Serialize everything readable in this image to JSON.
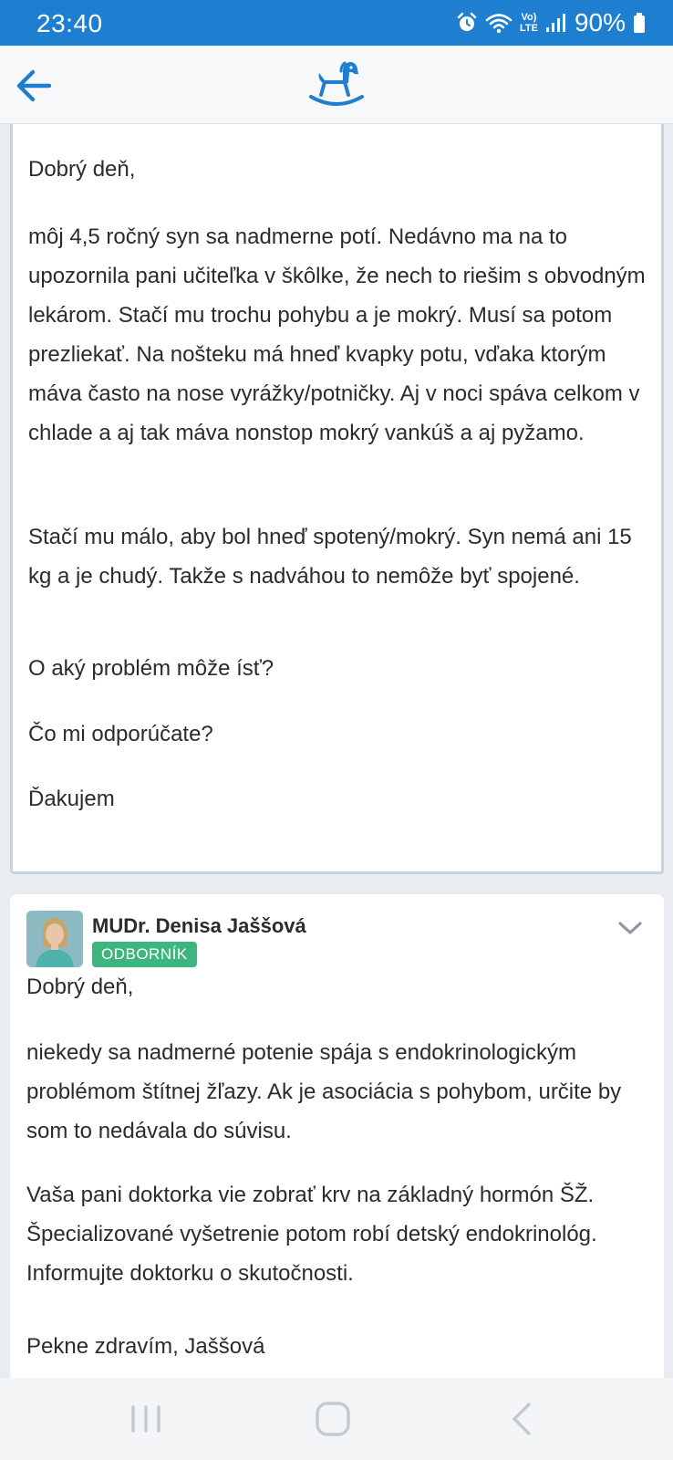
{
  "status_bar": {
    "time": "23:40",
    "battery": "90%",
    "network_label_top": "Vo)",
    "network_label_bottom": "LTE",
    "icons": [
      "alarm-icon",
      "wifi-icon",
      "volte-icon",
      "signal-icon",
      "battery-icon"
    ]
  },
  "app_bar": {
    "back_icon": "arrow-left-icon",
    "logo_icon": "rocking-horse-icon"
  },
  "colors": {
    "status_bar": "#1e7fd0",
    "accent": "#1e7fd0",
    "badge": "#3cb57e",
    "text": "#2b2b2b"
  },
  "question": {
    "greeting": "Dobrý deň,",
    "paragraphs": [
      "môj 4,5 ročný syn sa nadmerne potí. Nedávno ma na to upozornila pani učiteľka v škôlke, že nech to riešim s obvodným lekárom. Stačí mu trochu pohybu a je mokrý. Musí sa potom prezliekať. Na nošteku má hneď kvapky potu, vďaka ktorým máva často na nose vyrážky/potničky. Aj v noci spáva celkom v chlade a aj tak máva nonstop mokrý vankúš a aj pyžamo.",
      "Stačí mu málo, aby bol hneď spotený/mokrý. Syn nemá ani 15 kg a je chudý. Takže s nadváhou to nemôže byť spojené.",
      "O aký problém môže ísť?",
      "Čo mi odporúčate?",
      "Ďakujem"
    ]
  },
  "answer": {
    "author": "MUDr. Denisa Jaššová",
    "role": "ODBORNÍK",
    "greeting": "Dobrý deň,",
    "paragraphs": [
      "niekedy sa nadmerné potenie spája s endokrinologickým problémom štítnej žľazy. Ak je asociácia s pohybom, určite by som to nedávala do súvisu.",
      "Vaša pani doktorka vie zobrať krv na základný hormón ŠŽ. Špecializované vyšetrenie potom robí detský endokrinológ. Informujte doktorku o skutočnosti.",
      "Pekne zdravím, Jaššová"
    ]
  },
  "nav_bar": {
    "icons": [
      "recent-apps-icon",
      "home-icon",
      "back-icon"
    ]
  }
}
